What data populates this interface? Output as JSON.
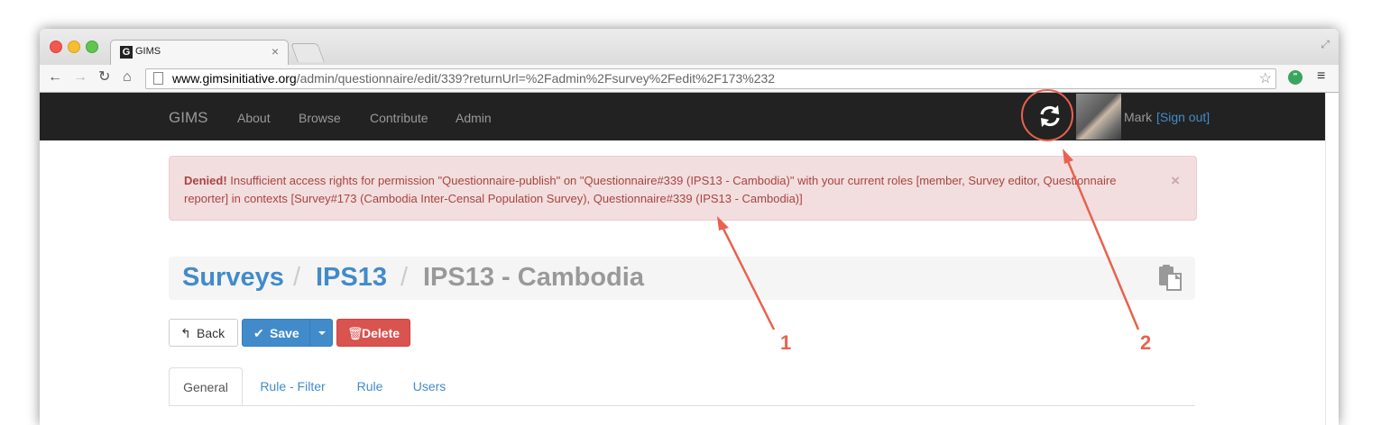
{
  "browser": {
    "tab_favicon": "G",
    "tab_title": "GIMS",
    "tab_close": "×",
    "url_host": "www.gimsinitiative.org",
    "url_path": "/admin/questionnaire/edit/339?returnUrl=%2Fadmin%2Fsurvey%2Fedit%2F173%232",
    "extension_letter": "\"",
    "icons": [
      "back-icon",
      "forward-icon",
      "reload-icon",
      "home-icon",
      "page-icon",
      "star-icon",
      "menu-icon",
      "fullscreen-icon"
    ]
  },
  "navbar": {
    "brand": "GIMS",
    "links": [
      "About",
      "Browse",
      "Contribute",
      "Admin"
    ],
    "user_name": "Mark",
    "sign_out": "[Sign out]",
    "bg_color": "#222222"
  },
  "alert": {
    "strong": "Denied!",
    "message": " Insufficient access rights for permission \"Questionnaire-publish\" on \"Questionnaire#339 (IPS13 - Cambodia)\" with your current roles [member, Survey editor, Questionnaire reporter] in contexts [Survey#173 (Cambodia Inter-Censal Population Survey), Questionnaire#339 (IPS13 - Cambodia)]",
    "close": "×",
    "bg_color": "#f2dede",
    "text_color": "#a94442"
  },
  "breadcrumb": {
    "items": [
      "Surveys",
      "IPS13",
      "IPS13 - Cambodia"
    ],
    "separator": "/"
  },
  "buttons": {
    "back": "Back",
    "save": "Save",
    "delete": "Delete"
  },
  "tabs": [
    "General",
    "Rule - Filter",
    "Rule",
    "Users"
  ],
  "annotations": {
    "labels": [
      "1",
      "2"
    ],
    "color": "#e8624f"
  },
  "colors": {
    "primary": "#428bca",
    "danger": "#d9534f"
  }
}
